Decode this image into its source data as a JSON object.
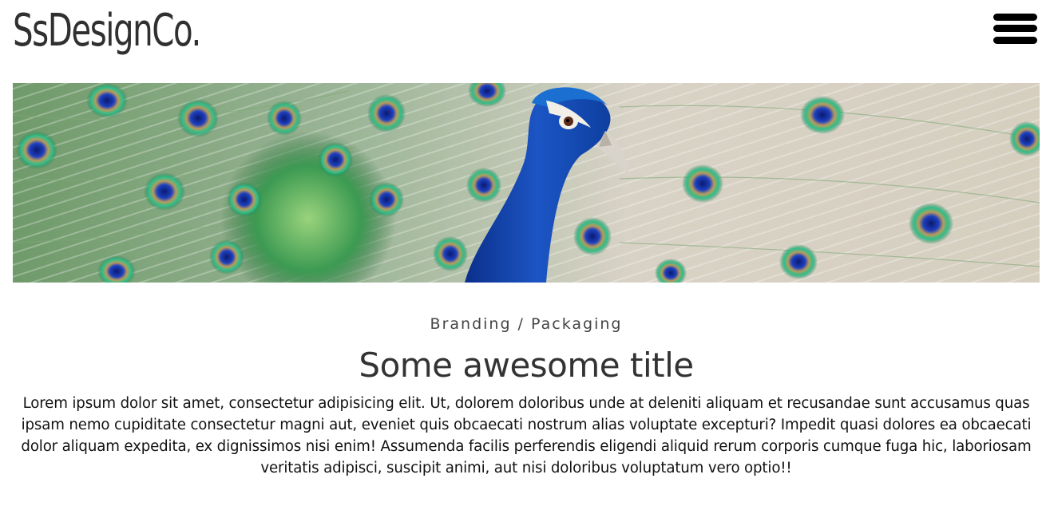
{
  "header": {
    "logo_text": "SsDesignCo.",
    "menu_icon": "hamburger-menu-icon"
  },
  "hero": {
    "image_subject": "peacock-photo"
  },
  "article": {
    "category": "Branding / Packaging",
    "title": "Some awesome title",
    "body": "Lorem ipsum dolor sit amet, consectetur adipisicing elit. Ut, dolorem doloribus unde at deleniti aliquam et recusandae sunt accusamus quas ipsam nemo cupiditate consectetur magni aut, eveniet quis obcaecati nostrum alias voluptate excepturi? Impedit quasi dolores ea obcaecati dolor aliquam expedita, ex dignissimos nisi enim! Assumenda facilis perferendis eligendi aliquid rerum corporis cumque fuga hic, laboriosam veritatis adipisci, suscipit animi, aut nisi doloribus voluptatum vero optio!!"
  },
  "colors": {
    "text": "#333333",
    "menu_icon": "#000000",
    "peacock_blue": "#1c4fb0",
    "feather_green": "#2fa36a",
    "feather_tan": "#c9c2b2"
  }
}
